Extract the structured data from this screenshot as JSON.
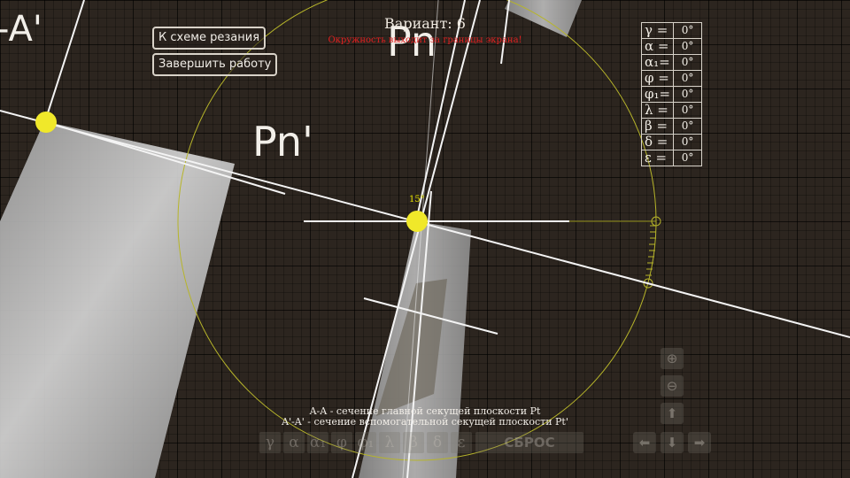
{
  "header": {
    "variant": "Вариант: 6",
    "warning": "Окружность выходит за границы экрана!"
  },
  "buttons": {
    "to_scheme": "К схеме резания",
    "finish": "Завершить работу"
  },
  "plane_labels": {
    "pn_top": "Pn",
    "pn_mid": "Pn'",
    "section_a": "-A'"
  },
  "angle_marker": "15°",
  "angles": [
    {
      "symbol": "γ =",
      "value": "0°"
    },
    {
      "symbol": "α =",
      "value": "0°"
    },
    {
      "symbol": "α₁=",
      "value": "0°"
    },
    {
      "symbol": "φ =",
      "value": "0°"
    },
    {
      "symbol": "φ₁=",
      "value": "0°"
    },
    {
      "symbol": "λ =",
      "value": "0°"
    },
    {
      "symbol": "β =",
      "value": "0°"
    },
    {
      "symbol": "δ =",
      "value": "0°"
    },
    {
      "symbol": "ε =",
      "value": "0°"
    }
  ],
  "captions": {
    "line1": "A-A - сечение главной секущей плоскости Pt",
    "line2": "A'-A' - сечение вспомогательной секущей плоскости Pt'"
  },
  "toolbar": [
    "γ",
    "α",
    "α₁",
    "φ",
    "φ₁",
    "λ",
    "β",
    "δ",
    "ε",
    "СБРОС"
  ],
  "nav": {
    "zoom_in": "⊕",
    "zoom_out": "⊖",
    "up": "⬆",
    "left": "⬅",
    "down": "⬇",
    "right": "➡"
  },
  "colors": {
    "background": "#2c251f",
    "construction_circle": "#b7b52a",
    "intersection_point": "#f0e82a",
    "warning": "#e02020"
  }
}
